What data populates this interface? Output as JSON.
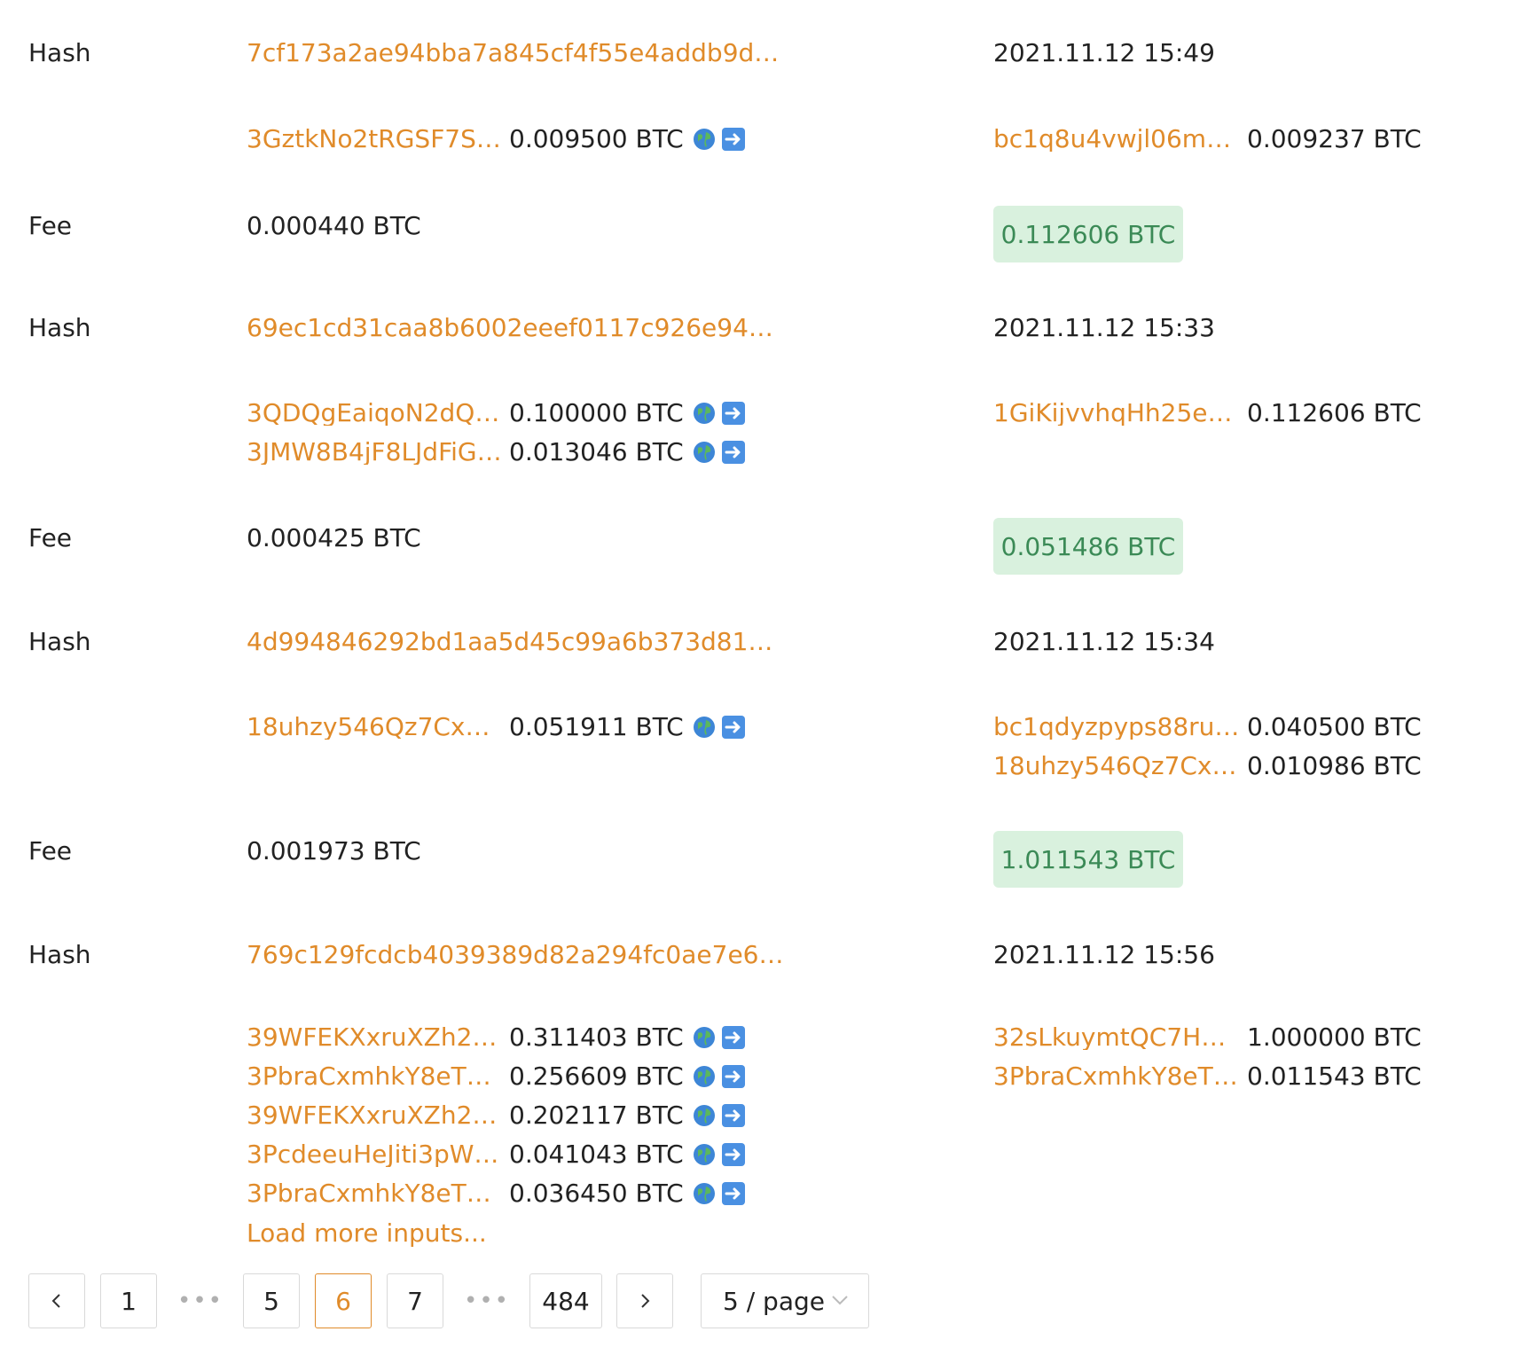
{
  "labels": {
    "hash": "Hash",
    "fee": "Fee"
  },
  "transactions": [
    {
      "hash": "7cf173a2ae94bba7a845cf4f55e4addb9d…",
      "date": "2021.11.12 15:49",
      "inputs": [
        {
          "address": "3GztkNo2tRGSF7Sx…",
          "amount": "0.009500 BTC"
        }
      ],
      "outputs": [
        {
          "address": "bc1q8u4vwjl06mcp…",
          "amount": "0.009237 BTC"
        }
      ],
      "fee": "0.000440 BTC",
      "total": "0.112606 BTC"
    },
    {
      "hash": "69ec1cd31caa8b6002eeef0117c926e94…",
      "date": "2021.11.12 15:33",
      "inputs": [
        {
          "address": "3QDQgEaiqoN2dQu…",
          "amount": "0.100000 BTC"
        },
        {
          "address": "3JMW8B4jF8LJdFiG…",
          "amount": "0.013046 BTC"
        }
      ],
      "outputs": [
        {
          "address": "1GiKijvvhqHh25eYY…",
          "amount": "0.112606 BTC"
        }
      ],
      "fee": "0.000425 BTC",
      "total": "0.051486 BTC"
    },
    {
      "hash": "4d994846292bd1aa5d45c99a6b373d81…",
      "date": "2021.11.12 15:34",
      "inputs": [
        {
          "address": "18uhzy546Qz7CxR…",
          "amount": "0.051911 BTC"
        }
      ],
      "outputs": [
        {
          "address": "bc1qdyzpyps88ruhg…",
          "amount": "0.040500 BTC"
        },
        {
          "address": "18uhzy546Qz7CxR…",
          "amount": "0.010986 BTC"
        }
      ],
      "fee": "0.001973 BTC",
      "total": "1.011543 BTC"
    },
    {
      "hash": "769c129fcdcb4039389d82a294fc0ae7e6…",
      "date": "2021.11.12 15:56",
      "inputs": [
        {
          "address": "39WFEKXxruXZh2G…",
          "amount": "0.311403 BTC"
        },
        {
          "address": "3PbraCxmhkY8eT2Y…",
          "amount": "0.256609 BTC"
        },
        {
          "address": "39WFEKXxruXZh2G…",
          "amount": "0.202117 BTC"
        },
        {
          "address": "3PcdeeuHeJiti3pW6…",
          "amount": "0.041043 BTC"
        },
        {
          "address": "3PbraCxmhkY8eT2Y…",
          "amount": "0.036450 BTC"
        }
      ],
      "outputs": [
        {
          "address": "32sLkuymtQC7HRE…",
          "amount": "1.000000 BTC"
        },
        {
          "address": "3PbraCxmhkY8eT2Y…",
          "amount": "0.011543 BTC"
        }
      ],
      "load_more": "Load more inputs..."
    }
  ],
  "icons": {
    "input_globe": "globe-icon",
    "input_arrow": "arrow-right-icon"
  },
  "pagination": {
    "prev": "<",
    "next": ">",
    "pages": [
      "1",
      "5",
      "6",
      "7",
      "484"
    ],
    "current": "6",
    "ellipsis": "•••",
    "page_size": "5 / page"
  },
  "colors": {
    "link": "#e08b2a",
    "total_bg": "#d9f1de",
    "total_text": "#3b8a56",
    "border": "#d9d9d9"
  }
}
